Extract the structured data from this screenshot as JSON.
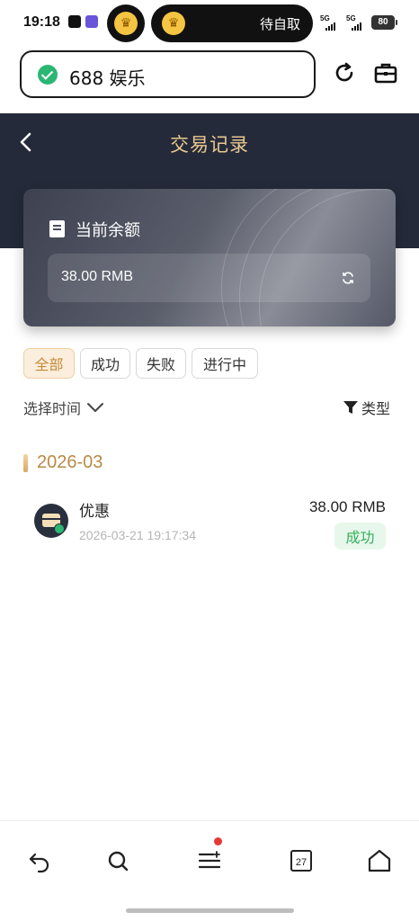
{
  "status_bar": {
    "time": "19:18",
    "pill_text": "待自取",
    "signal_1": "5G",
    "signal_2": "5G",
    "battery": "80"
  },
  "browser": {
    "address_text": "688 娱乐",
    "reload_icon": "reload-icon",
    "briefcase_icon": "briefcase-icon"
  },
  "header": {
    "title": "交易记录"
  },
  "balance": {
    "label": "当前余额",
    "value": "38.00 RMB"
  },
  "filters": {
    "chips": [
      "全部",
      "成功",
      "失败",
      "进行中"
    ],
    "active_index": 0,
    "time_label": "选择时间",
    "type_label": "类型"
  },
  "transactions": {
    "month": "2026-03",
    "items": [
      {
        "name": "优惠",
        "time": "2026-03-21 19:17:34",
        "amount": "38.00 RMB",
        "status": "成功"
      }
    ]
  },
  "bottom_nav": {
    "calendar_day": "27",
    "icons": [
      "back-icon",
      "search-icon",
      "menu-icon",
      "calendar-icon",
      "home-icon"
    ]
  },
  "colors": {
    "header_bg": "#252a3a",
    "accent_gold": "#e8c88f",
    "success_green": "#33b05c",
    "chip_active": "#c6893a"
  }
}
